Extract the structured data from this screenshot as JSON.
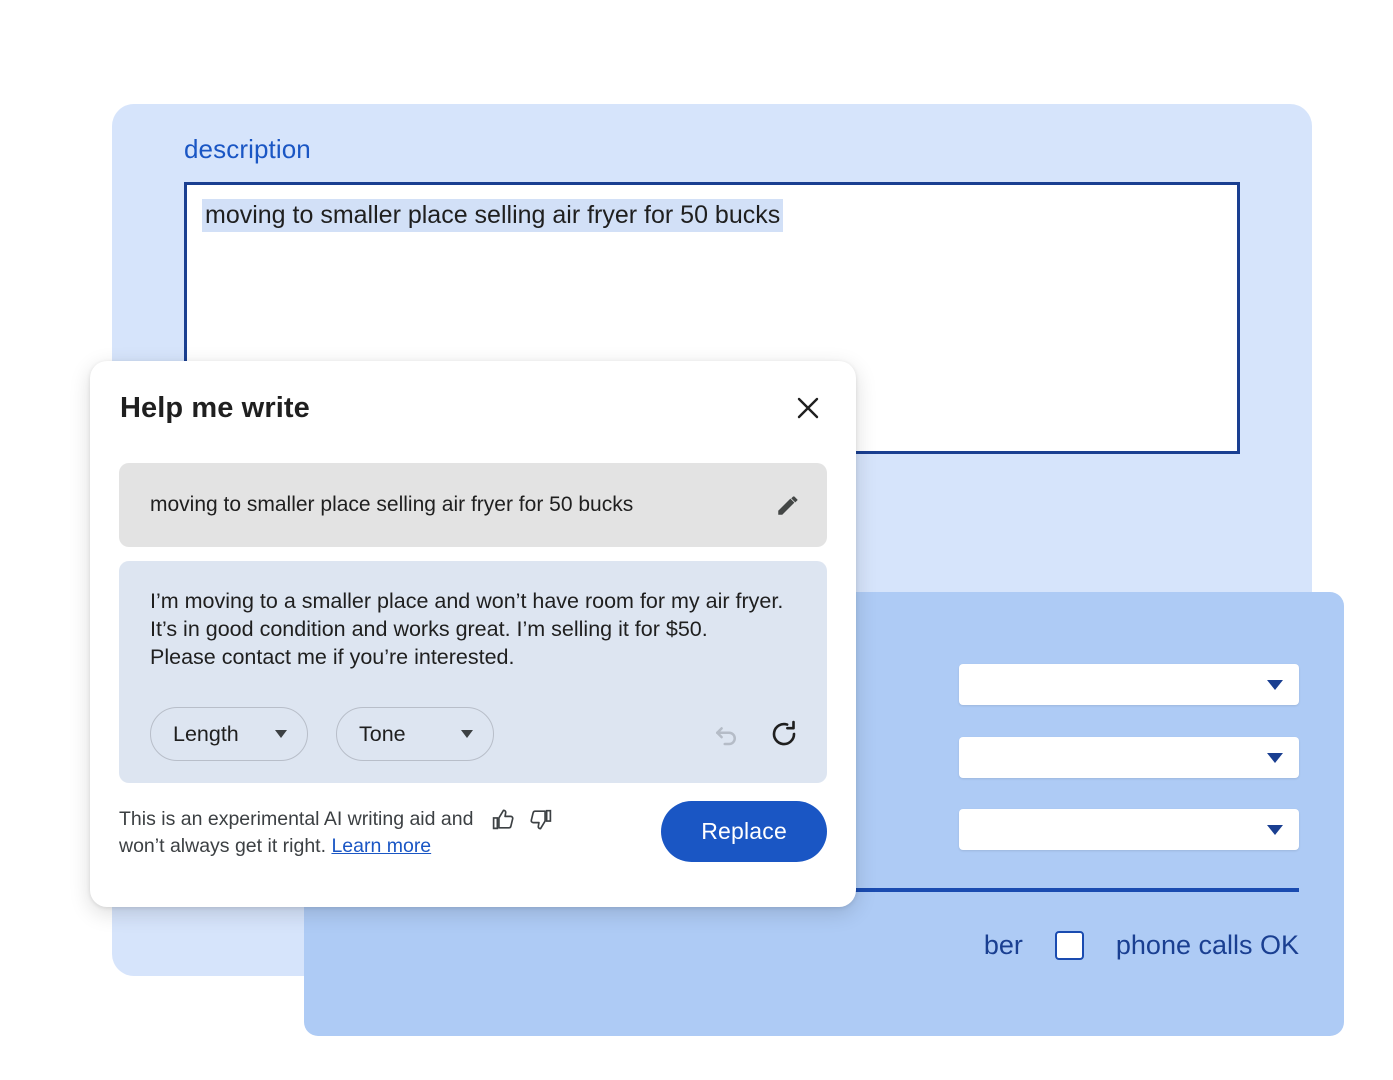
{
  "background_form": {
    "field_label": "description",
    "textarea_value": "moving to smaller place selling air fryer for 50 bucks",
    "selects": [
      {
        "value": "",
        "caret_icon": "caret-down-icon"
      },
      {
        "value": "",
        "caret_icon": "caret-down-icon"
      },
      {
        "value": "",
        "caret_icon": "caret-down-icon"
      }
    ],
    "occluded_label": "ber",
    "checkbox_label": "phone calls OK",
    "checkbox_checked": false,
    "colors": {
      "outer_card": "#d6e4fb",
      "inner_panel": "#aecbf5",
      "label_blue": "#1a56c4",
      "textarea_border": "#1a3f91",
      "divider": "#1a4bb0",
      "selection_highlight": "#d2e0f7"
    }
  },
  "dialog": {
    "title": "Help me write",
    "close_icon": "close-icon",
    "prompt": {
      "text": "moving to smaller place selling air fryer for 50 bucks",
      "edit_icon": "pencil-icon"
    },
    "result": {
      "text": "I’m moving to a smaller place and won’t have room for my air fryer.\nIt’s in good condition and works great. I’m selling it for $50.\nPlease contact me if you’re interested.",
      "controls": [
        {
          "label": "Length",
          "caret_icon": "caret-down-icon"
        },
        {
          "label": "Tone",
          "caret_icon": "caret-down-icon"
        }
      ],
      "actions": [
        {
          "name": "undo",
          "icon": "undo-icon",
          "disabled": true
        },
        {
          "name": "refresh",
          "icon": "refresh-icon",
          "disabled": false
        }
      ]
    },
    "footer": {
      "disclaimer_line_1": "This is an experimental AI writing aid and",
      "disclaimer_line_2": "won’t always get it right.",
      "learn_more_label": "Learn more",
      "thumbs_up_icon": "thumb-up-icon",
      "thumbs_down_icon": "thumb-down-icon",
      "primary_button_label": "Replace"
    },
    "colors": {
      "prompt_chip": "#e3e3e3",
      "result_panel": "#dde5f1",
      "primary_button": "#1a56c4",
      "link": "#1a56c4"
    }
  }
}
